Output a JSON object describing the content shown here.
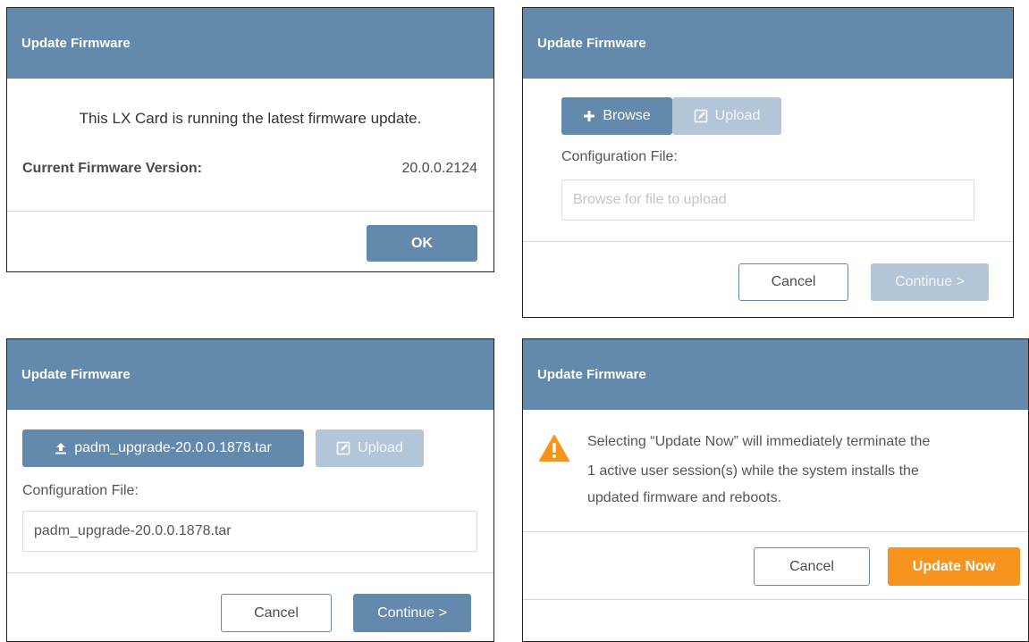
{
  "dialog1": {
    "title": "Update Firmware",
    "message": "This LX Card is running the latest firmware update.",
    "version_label": "Current Firmware Version:",
    "version_value": "20.0.0.2124",
    "ok_label": "OK"
  },
  "dialog2": {
    "title": "Update Firmware",
    "browse_label": "Browse",
    "upload_label": "Upload",
    "file_label": "Configuration File:",
    "file_placeholder": "Browse for file to upload",
    "cancel_label": "Cancel",
    "continue_label": "Continue >"
  },
  "dialog3": {
    "title": "Update Firmware",
    "selected_file_button": "padm_upgrade-20.0.0.1878.tar",
    "upload_label": "Upload",
    "file_label": "Configuration File:",
    "file_value": "padm_upgrade-20.0.0.1878.tar",
    "cancel_label": "Cancel",
    "continue_label": "Continue >"
  },
  "dialog4": {
    "title": "Update Firmware",
    "warning_line1": "Selecting “Update Now” will immediately terminate the",
    "warning_line2": "1 active user session(s) while the system installs the",
    "warning_line3": "updated firmware and reboots.",
    "cancel_label": "Cancel",
    "update_now_label": "Update Now"
  },
  "colors": {
    "header": "#6389ad",
    "primary": "#6389ad",
    "disabled": "#b3c5d8",
    "warning": "#f7941d"
  },
  "icons": {
    "browse": "plus-icon",
    "upload": "edit-icon",
    "file": "upload-icon",
    "warning": "warning-triangle-icon"
  }
}
